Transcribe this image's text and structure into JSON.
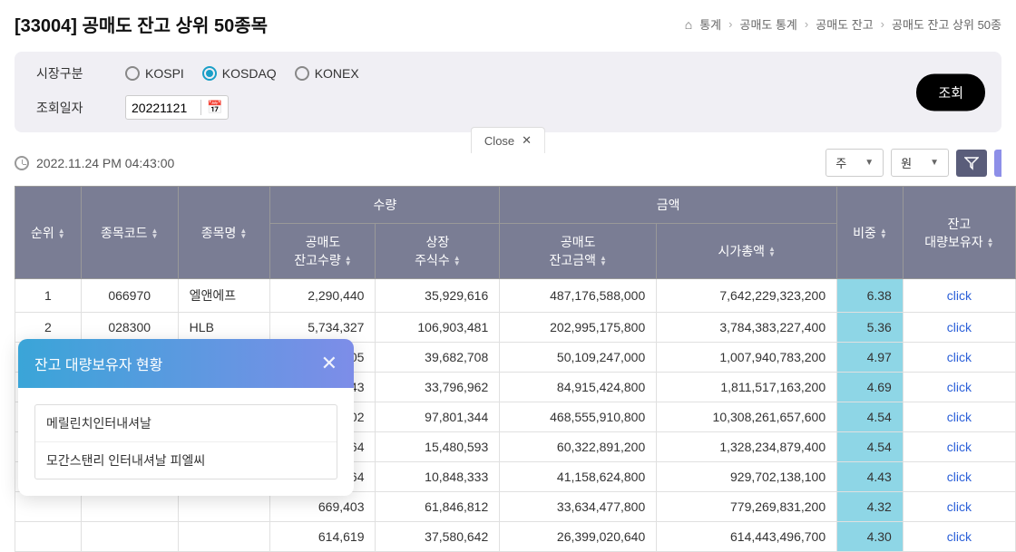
{
  "page": {
    "title": "[33004] 공매도 잔고 상위 50종목"
  },
  "breadcrumb": {
    "items": [
      "통계",
      "공매도 통계",
      "공매도 잔고",
      "공매도 잔고 상위 50종"
    ]
  },
  "filter": {
    "market_label": "시장구분",
    "date_label": "조회일자",
    "markets": [
      "KOSPI",
      "KOSDAQ",
      "KONEX"
    ],
    "date_value": "20221121",
    "search_btn": "조회"
  },
  "close_tab": "Close",
  "timestamp": "2022.11.24 PM 04:43:00",
  "selects": {
    "unit1": "주",
    "unit2": "원"
  },
  "table": {
    "headers": {
      "rank": "순위",
      "code": "종목코드",
      "name": "종목명",
      "qty_group": "수량",
      "amt_group": "금액",
      "short_qty": "공매도\n잔고수량",
      "listed_qty": "상장\n주식수",
      "short_amt": "공매도\n잔고금액",
      "market_cap": "시가총액",
      "ratio": "비중",
      "holders": "잔고\n대량보유자"
    },
    "rows": [
      {
        "rank": "1",
        "code": "066970",
        "name": "엘앤에프",
        "sqty": "2,290,440",
        "lqty": "35,929,616",
        "samt": "487,176,588,000",
        "mcap": "7,642,229,323,200",
        "ratio": "6.38",
        "click": "click"
      },
      {
        "rank": "2",
        "code": "028300",
        "name": "HLB",
        "sqty": "5,734,327",
        "lqty": "106,903,481",
        "samt": "202,995,175,800",
        "mcap": "3,784,383,227,400",
        "ratio": "5.36",
        "click": "click"
      },
      {
        "rank": "",
        "code": "",
        "name": "",
        "sqty": "1,972,805",
        "lqty": "39,682,708",
        "samt": "50,109,247,000",
        "mcap": "1,007,940,783,200",
        "ratio": "4.97",
        "click": "click"
      },
      {
        "rank": "",
        "code": "",
        "name": "",
        "sqty": "584,243",
        "lqty": "33,796,962",
        "samt": "84,915,424,800",
        "mcap": "1,811,517,163,200",
        "ratio": "4.69",
        "click": "click"
      },
      {
        "rank": "",
        "code": "",
        "name": "",
        "sqty": "445,502",
        "lqty": "97,801,344",
        "samt": "468,555,910,800",
        "mcap": "10,308,261,657,600",
        "ratio": "4.54",
        "click": "click"
      },
      {
        "rank": "",
        "code": "",
        "name": "",
        "sqty": "703,064",
        "lqty": "15,480,593",
        "samt": "60,322,891,200",
        "mcap": "1,328,234,879,400",
        "ratio": "4.54",
        "click": "click"
      },
      {
        "rank": "",
        "code": "",
        "name": "",
        "sqty": "480,264",
        "lqty": "10,848,333",
        "samt": "41,158,624,800",
        "mcap": "929,702,138,100",
        "ratio": "4.43",
        "click": "click"
      },
      {
        "rank": "",
        "code": "",
        "name": "",
        "sqty": "669,403",
        "lqty": "61,846,812",
        "samt": "33,634,477,800",
        "mcap": "779,269,831,200",
        "ratio": "4.32",
        "click": "click"
      },
      {
        "rank": "",
        "code": "",
        "name": "",
        "sqty": "614,619",
        "lqty": "37,580,642",
        "samt": "26,399,020,640",
        "mcap": "614,443,496,700",
        "ratio": "4.30",
        "click": "click"
      }
    ]
  },
  "popup": {
    "title": "잔고 대량보유자 현황",
    "items": [
      "메릴린치인터내셔날",
      "모간스탠리 인터내셔날 피엘씨"
    ]
  }
}
